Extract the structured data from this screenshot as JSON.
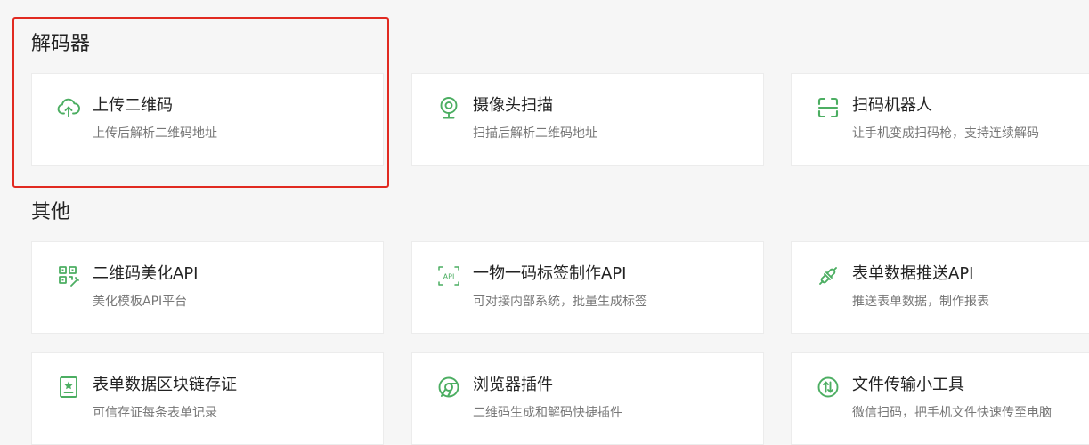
{
  "sections": {
    "decoder": {
      "title": "解码器",
      "cards": [
        {
          "title": "上传二维码",
          "desc": "上传后解析二维码地址",
          "icon": "cloud-upload-icon"
        },
        {
          "title": "摄像头扫描",
          "desc": "扫描后解析二维码地址",
          "icon": "webcam-icon"
        },
        {
          "title": "扫码机器人",
          "desc": "让手机变成扫码枪，支持连续解码",
          "icon": "scan-frame-icon"
        }
      ]
    },
    "other": {
      "title": "其他",
      "cards": [
        {
          "title": "二维码美化API",
          "desc": "美化模板API平台",
          "icon": "qr-brush-icon"
        },
        {
          "title": "一物一码标签制作API",
          "desc": "可对接内部系统，批量生成标签",
          "icon": "api-tag-icon"
        },
        {
          "title": "表单数据推送API",
          "desc": "推送表单数据，制作报表",
          "icon": "plug-connect-icon"
        },
        {
          "title": "表单数据区块链存证",
          "desc": "可信存证每条表单记录",
          "icon": "certificate-star-icon"
        },
        {
          "title": "浏览器插件",
          "desc": "二维码生成和解码快捷插件",
          "icon": "browser-icon"
        },
        {
          "title": "文件传输小工具",
          "desc": "微信扫码，把手机文件快速传至电脑",
          "icon": "transfer-arrows-icon"
        }
      ]
    }
  },
  "colors": {
    "accent": "#4cae62",
    "highlight": "#e12a21",
    "background": "#f6f6f6"
  }
}
